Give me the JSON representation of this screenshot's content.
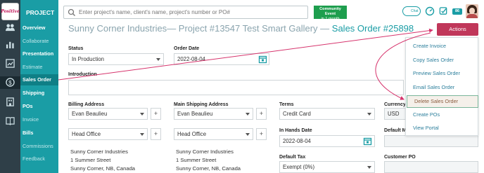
{
  "brand": {
    "logo_text": "Positive"
  },
  "sidebar": {
    "title": "PROJECT",
    "items": [
      {
        "label": "Overview",
        "style": "bold"
      },
      {
        "label": "Collaborate",
        "style": "light"
      },
      {
        "label": "Presentation",
        "style": "bold"
      },
      {
        "label": "Estimate",
        "style": "light"
      },
      {
        "label": "Sales Order",
        "style": "active"
      },
      {
        "label": "Shipping",
        "style": "bold"
      },
      {
        "label": "POs",
        "style": "bold"
      },
      {
        "label": "Invoice",
        "style": "light"
      },
      {
        "label": "Bills",
        "style": "bold"
      },
      {
        "label": "Commissions",
        "style": "light"
      },
      {
        "label": "Feedback",
        "style": "light"
      }
    ],
    "rail_icons": [
      "people-icon",
      "chart-icon",
      "report-icon",
      "dollar-icon",
      "building-icon",
      "book-icon"
    ]
  },
  "topbar": {
    "search_placeholder": "Enter project's name, client's name, project's number or PO#",
    "event_title": "Community Event",
    "event_subtitle": "in 1 month",
    "chat_label": "Chat",
    "badge": "86"
  },
  "header": {
    "company": "Sunny Corner Industries",
    "project": "— Project #13547 Test Smart Gallery —",
    "sales_order": "Sales Order #25898",
    "actions_label": "Actions"
  },
  "form": {
    "status_label": "Status",
    "status_value": "In Production",
    "order_date_label": "Order Date",
    "order_date_value": "2022-08-04",
    "introduction_label": "Introduction",
    "billing_label": "Billing Address",
    "billing_contact": "Evan Beaulieu",
    "billing_location": "Head Office",
    "billing_address": [
      "Sunny Corner Industries",
      "1 Summer Street",
      "Sunny Corner, NB, Canada"
    ],
    "shipping_label": "Main Shipping Address",
    "shipping_contact": "Evan Beaulieu",
    "shipping_location": "Head Office",
    "shipping_address": [
      "Sunny Corner Industries",
      "1 Summer Street",
      "Sunny Corner, NB, Canada"
    ],
    "terms_label": "Terms",
    "terms_value": "Credit Card",
    "in_hands_label": "In Hands Date",
    "in_hands_value": "2022-08-04",
    "default_tax_label": "Default Tax",
    "default_tax_value": "Exempt (0%)",
    "currency_label": "Currency",
    "currency_value": "USD",
    "default_margin_label": "Default Ma",
    "customer_po_label": "Customer PO",
    "plus_glyph": "+"
  },
  "actions_menu": [
    {
      "label": "Create Invoice",
      "highlight": false
    },
    {
      "label": "Copy Sales Order",
      "highlight": false
    },
    {
      "label": "Preview Sales Order",
      "highlight": false
    },
    {
      "label": "Email Sales Order",
      "highlight": false
    },
    {
      "label": "Delete Sales Order",
      "highlight": true
    },
    {
      "label": "Create POs",
      "highlight": false
    },
    {
      "label": "View Portal",
      "highlight": false
    }
  ],
  "colors": {
    "sidebar": "#1a9da5",
    "rail": "#2f3f48",
    "actions": "#c0375a",
    "arrow": "#d6336c",
    "menu_link": "#2c7f9c"
  }
}
